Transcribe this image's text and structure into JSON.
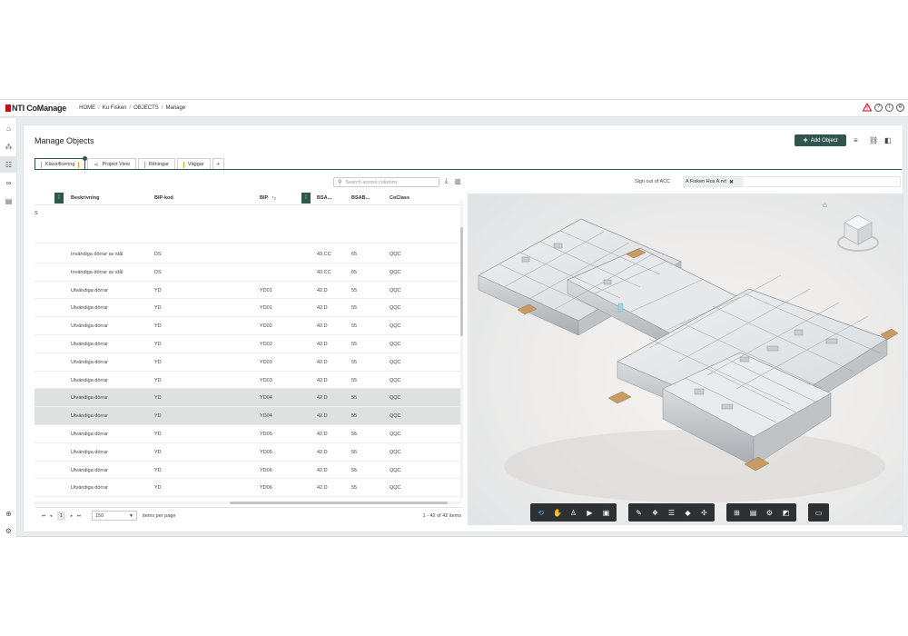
{
  "app": {
    "brand": "NTI CoManage"
  },
  "breadcrumb": [
    "HOME",
    "Ku Fisken",
    "OBJECTS",
    "Manage"
  ],
  "topbar_icons": [
    "warning-icon",
    "help-icon",
    "info-icon",
    "notification-icon"
  ],
  "rail_icons": [
    "building-icon",
    "objects-icon",
    "list-icon",
    "link-icon",
    "document-icon",
    "add-icon",
    "settings-icon"
  ],
  "page": {
    "title": "Manage Objects",
    "add_label": "Add Object"
  },
  "tabs": [
    {
      "label": "Klassificering"
    },
    {
      "label": "Project View"
    },
    {
      "label": "Ritningar"
    },
    {
      "label": "Väggar"
    },
    {
      "label": "+"
    }
  ],
  "search": {
    "placeholder": "Search across columns"
  },
  "acc": {
    "label": "Sign out of ACC",
    "chip": "A Fisken Hus A.rvt"
  },
  "table": {
    "columns": [
      "Beskrivning",
      "BIP-kod",
      "BIP",
      "BSA...",
      "BSAB...",
      "CoClass"
    ],
    "sort_marker": "↑₂",
    "group": "S",
    "rows": [
      [
        "Invändiga dörrar av stål",
        "DS",
        "",
        "43.CC",
        "65",
        "QQC"
      ],
      [
        "Invändiga dörrar av stål",
        "DS",
        "",
        "43.CC",
        "65",
        "QQC"
      ],
      [
        "Utvändiga dörrar",
        "YD",
        "YD01",
        "42.D",
        "55",
        "QQC"
      ],
      [
        "Utvändiga dörrar",
        "YD",
        "YD01",
        "42.D",
        "55",
        "QQC"
      ],
      [
        "Utvändiga dörrar",
        "YD",
        "YD02",
        "42.D",
        "55",
        "QQC"
      ],
      [
        "Utvändiga dörrar",
        "YD",
        "YD02",
        "42.D",
        "55",
        "QQC"
      ],
      [
        "Utvändiga dörrar",
        "YD",
        "YD03",
        "42.D",
        "55",
        "QQC"
      ],
      [
        "Utvändiga dörrar",
        "YD",
        "YD03",
        "42.D",
        "55",
        "QQC"
      ],
      [
        "Utvändiga dörrar",
        "YD",
        "YD04",
        "42.D",
        "55",
        "QQC"
      ],
      [
        "Utvändiga dörrar",
        "YD",
        "YD04",
        "42.D",
        "55",
        "QQC"
      ],
      [
        "Utvändiga dörrar",
        "YD",
        "YD05",
        "42.D",
        "55",
        "QQC"
      ],
      [
        "Utvändiga dörrar",
        "YD",
        "YD05",
        "42.D",
        "55",
        "QQC"
      ],
      [
        "Utvändiga dörrar",
        "YD",
        "YD06",
        "42.D",
        "55",
        "QQC"
      ],
      [
        "Utvändiga dörrar",
        "YD",
        "YD06",
        "42.D",
        "55",
        "QQC"
      ]
    ],
    "selected_rows": [
      8,
      9
    ]
  },
  "pager": {
    "page": "1",
    "page_size": "150",
    "per_page_label": "items per page",
    "range": "1 - 42 of 42 items"
  },
  "viewer_toolbar": [
    "orbit-icon",
    "pan-icon",
    "walk-icon",
    "camera-icon",
    "section-icon",
    "measure-icon",
    "explode-icon",
    "layers-icon",
    "model-icon",
    "properties-icon",
    "tree-icon",
    "sheets-icon",
    "settings-icon",
    "fullscreen-icon",
    "minimap-icon"
  ],
  "colors": {
    "accent": "#30554f",
    "tab_marker": "#e7a32b",
    "brand_red": "#d0021b",
    "toolbar": "#2e3133",
    "toolbar_active": "#41b6e6"
  }
}
